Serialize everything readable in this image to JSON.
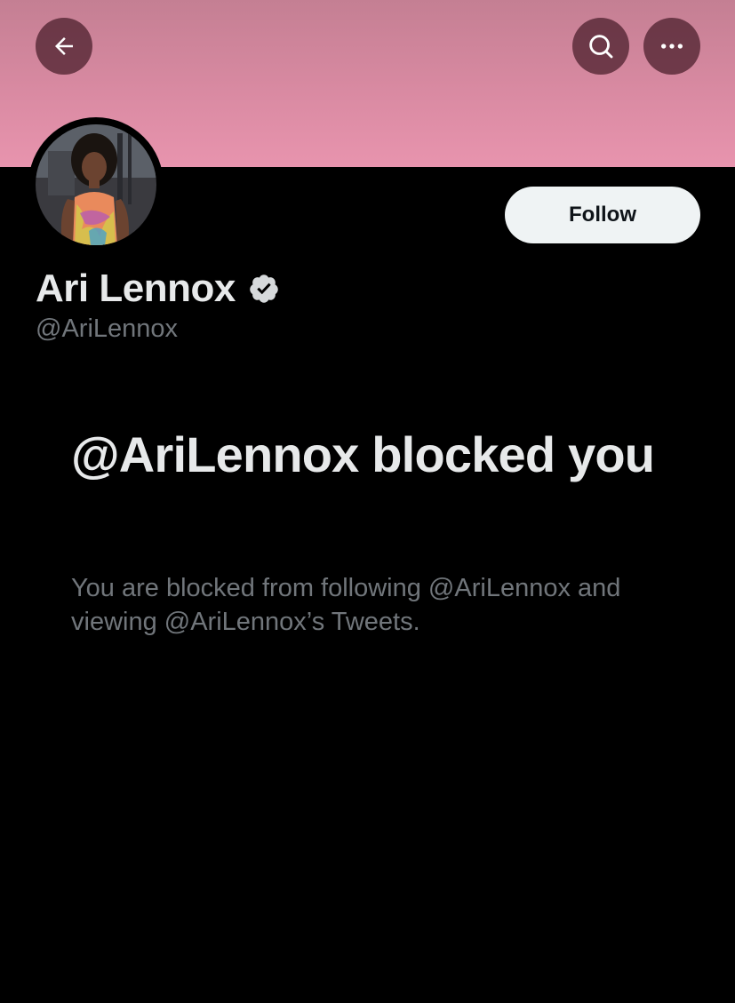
{
  "profile": {
    "display_name": "Ari Lennox",
    "handle": "@AriLennox",
    "verified": true,
    "avatar_icon": "profile-photo"
  },
  "header": {
    "back_icon": "arrow-left-icon",
    "search_icon": "search-icon",
    "more_icon": "more-horizontal-icon"
  },
  "actions": {
    "follow_label": "Follow"
  },
  "blocked": {
    "title": "@AriLennox blocked you",
    "description": "You are blocked from following @AriLennox and viewing @AriLennox’s Tweets."
  },
  "colors": {
    "background": "#000000",
    "banner": "#e894ae",
    "text_primary": "#e7e9ea",
    "text_secondary": "#71767b",
    "follow_button_bg": "#eff3f4"
  }
}
